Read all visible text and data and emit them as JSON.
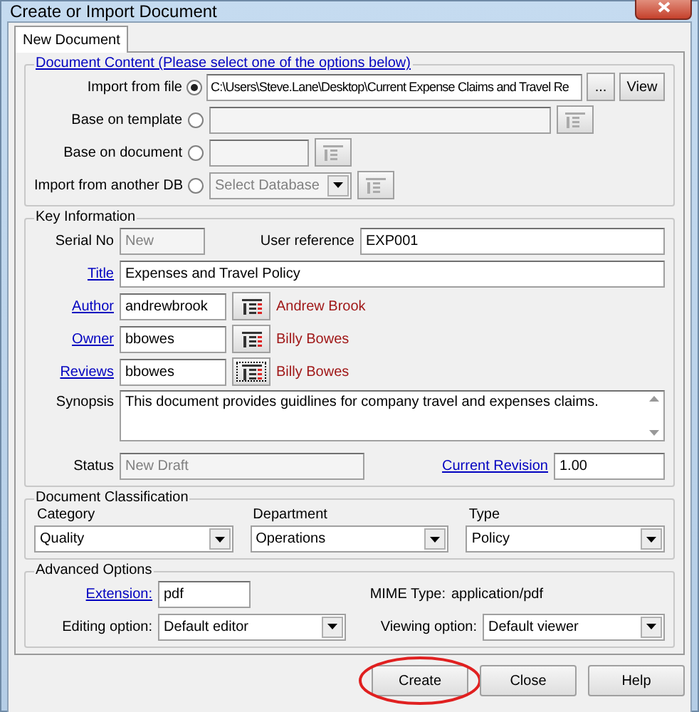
{
  "window": {
    "title": "Create or Import Document"
  },
  "tabs": [
    {
      "label": "New Document",
      "selected": true
    }
  ],
  "document_content": {
    "legend": "Document Content (Please select one of the options below)",
    "options": [
      {
        "kind": "file",
        "label": "Import from file",
        "selected": true,
        "value": "C:\\Users\\Steve.Lane\\Desktop\\Current Expense Claims and Travel Re",
        "browse": "...",
        "view": "View"
      },
      {
        "kind": "template",
        "label": "Base on template",
        "selected": false
      },
      {
        "kind": "document",
        "label": "Base on document",
        "selected": false
      },
      {
        "kind": "database",
        "label": "Import from another DB",
        "selected": false,
        "value": "Select Database"
      }
    ]
  },
  "key_information": {
    "legend": "Key Information",
    "serial_no": {
      "label": "Serial No",
      "value": "New"
    },
    "user_reference": {
      "label": "User reference",
      "value": "EXP001"
    },
    "title": {
      "label": "Title",
      "value": "Expenses and Travel Policy"
    },
    "people": [
      {
        "label": "Author",
        "value": "andrewbrook",
        "name": "Andrew Brook",
        "focused": false
      },
      {
        "label": "Owner",
        "value": "bbowes",
        "name": "Billy Bowes",
        "focused": false
      },
      {
        "label": "Reviews",
        "value": "bbowes",
        "name": "Billy Bowes",
        "focused": true
      }
    ],
    "synopsis": {
      "label": "Synopsis",
      "value": "This document provides guidlines for company travel and expenses claims."
    },
    "status": {
      "label": "Status",
      "value": "New Draft"
    },
    "current_revision": {
      "label": "Current Revision",
      "value": "1.00"
    }
  },
  "classification": {
    "legend": "Document Classification",
    "fields": [
      {
        "label": "Category",
        "value": "Quality"
      },
      {
        "label": "Department",
        "value": "Operations"
      },
      {
        "label": "Type",
        "value": "Policy"
      }
    ]
  },
  "advanced": {
    "legend": "Advanced Options",
    "extension": {
      "label": "Extension:",
      "value": "pdf"
    },
    "mime": {
      "label": "MIME Type:",
      "value": "application/pdf"
    },
    "editing": {
      "label": "Editing option:",
      "value": "Default editor"
    },
    "viewing": {
      "label": "Viewing option:",
      "value": "Default viewer"
    }
  },
  "buttons": [
    {
      "label": "Create",
      "highlighted": true
    },
    {
      "label": "Close",
      "highlighted": false
    },
    {
      "label": "Help",
      "highlighted": false
    }
  ]
}
